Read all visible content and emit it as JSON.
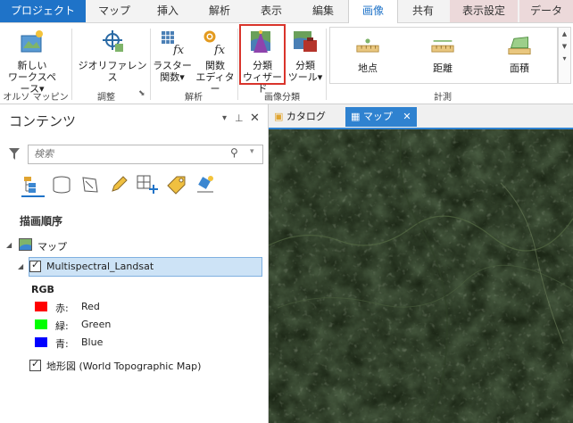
{
  "tabs": {
    "project": "プロジェクト",
    "map": "マップ",
    "insert": "挿入",
    "analysis": "解析",
    "view": "表示",
    "edit": "編集",
    "imagery": "画像",
    "share": "共有",
    "appearance": "表示設定",
    "data": "データ"
  },
  "ribbon": {
    "new_workspace": [
      "新しい",
      "ワークスペース"
    ],
    "georeference": "ジオリファレンス",
    "raster_functions": [
      "ラスター",
      "関数"
    ],
    "function_editor": [
      "関数",
      "エディター"
    ],
    "classify_wizard": [
      "分類",
      "ウィザード"
    ],
    "classify_tools": [
      "分類",
      "ツール"
    ],
    "point": "地点",
    "distance": "距離",
    "area": "面積",
    "groups": {
      "ortho": "オルソ マッピング",
      "adjust": "調整",
      "analysis": "解析",
      "classification": "画像分類",
      "measure": "計測"
    }
  },
  "contents": {
    "title": "コンテンツ",
    "search_placeholder": "検索",
    "drawing_order": "描画順序",
    "map_name": "マップ",
    "layer_name": "Multispectral_Landsat",
    "rgb_label": "RGB",
    "bands": [
      {
        "label": "赤:",
        "name": "Red",
        "color": "#ff0000"
      },
      {
        "label": "緑:",
        "name": "Green",
        "color": "#00ff00"
      },
      {
        "label": "青:",
        "name": "Blue",
        "color": "#0000ff"
      }
    ],
    "basemap": "地形図 (World Topographic Map)"
  },
  "view": {
    "catalog_tab": "カタログ",
    "map_tab": "マップ"
  },
  "colors": {
    "accent": "#1f73c8",
    "highlight_border": "#d9342b",
    "selection": "#cde3f6"
  }
}
